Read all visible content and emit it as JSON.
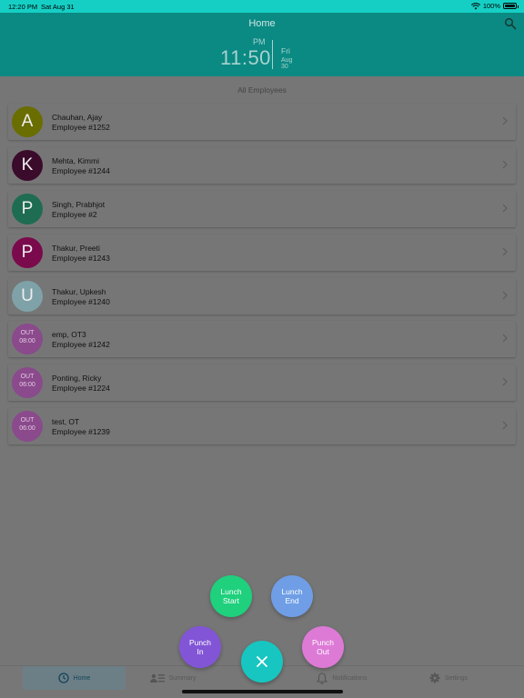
{
  "status_bar": {
    "time": "12:20 PM",
    "date": "Sat Aug 31",
    "battery": "100%"
  },
  "header": {
    "title": "Home",
    "clock": {
      "ampm": "PM",
      "time": "11:50",
      "day": "Fri",
      "date": "Aug 30"
    },
    "search_icon": "search-icon"
  },
  "section_title": "All Employees",
  "employees": [
    {
      "initial": "A",
      "name": "Chauhan, Ajay",
      "number": "Employee #1252",
      "color": "#6a6d00"
    },
    {
      "initial": "K",
      "name": "Mehta, Kimmi",
      "number": "Employee #1244",
      "color": "#3b0b2b"
    },
    {
      "initial": "P",
      "name": "Singh, Prabhjot",
      "number": "Employee #2",
      "color": "#1e6c52"
    },
    {
      "initial": "P",
      "name": "Thakur, Preeti",
      "number": "Employee #1243",
      "color": "#7a0a4c"
    },
    {
      "initial": "U",
      "name": "Thakur, Upkesh",
      "number": "Employee #1240",
      "color": "#7fa2a9"
    },
    {
      "out_label": "OUT",
      "out_time": "08:00",
      "name": "emp, OT3",
      "number": "Employee #1242",
      "color": "#8a4a8c"
    },
    {
      "out_label": "OUT",
      "out_time": "06:00",
      "name": "Ponting, Ricky",
      "number": "Employee #1224",
      "color": "#8a4a8c"
    },
    {
      "out_label": "OUT",
      "out_time": "06:00",
      "name": "test, OT",
      "number": "Employee #1239",
      "color": "#8a4a8c"
    }
  ],
  "fab": {
    "lunch_start": {
      "line1": "Lunch",
      "line2": "Start",
      "color": "#1fd07d"
    },
    "lunch_end": {
      "line1": "Lunch",
      "line2": "End",
      "color": "#6f9ee6"
    },
    "punch_in": {
      "line1": "Punch",
      "line2": "In",
      "color": "#8255d6"
    },
    "punch_out": {
      "line1": "Punch",
      "line2": "Out",
      "color": "#dd7ad6"
    },
    "close_icon": "close-icon",
    "color": "#17c6c0"
  },
  "tabs": [
    {
      "label": "Home",
      "icon": "clock-icon",
      "active": true
    },
    {
      "label": "Summary",
      "icon": "summary-icon",
      "active": false
    },
    {
      "label": "Notifications",
      "icon": "bell-icon",
      "active": false
    },
    {
      "label": "Settings",
      "icon": "gear-icon",
      "active": false
    }
  ]
}
